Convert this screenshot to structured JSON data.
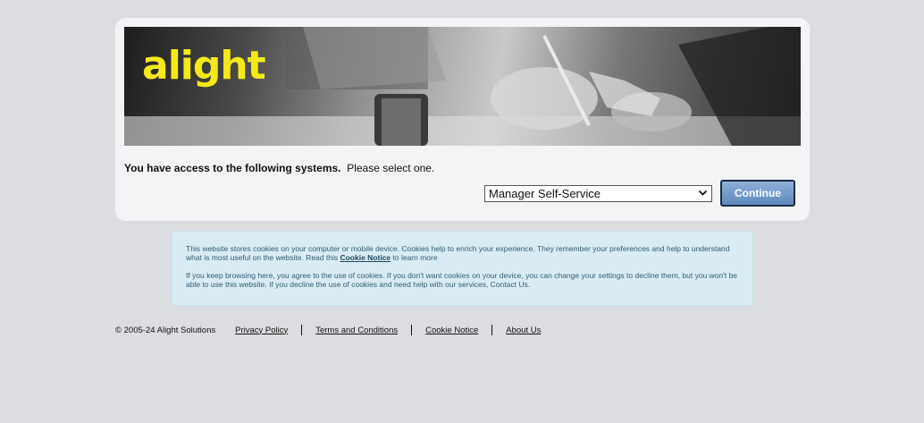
{
  "brand": {
    "logo_text": "alight",
    "logo_color": "#f5e918"
  },
  "selection": {
    "prompt_bold": "You have access to the following systems.",
    "prompt_rest": "Please select one.",
    "selected_system": "Manager Self-Service",
    "continue_label": "Continue"
  },
  "cookie_notice": {
    "p1_before": "This website stores cookies on your computer or mobile device. Cookies help to enrich your experience. They remember your preferences and help to understand what is most useful on the website. Read this ",
    "p1_link": "Cookie Notice",
    "p1_after": " to learn more",
    "p2": "If you keep browsing here, you agree to the use of cookies. If you don't want cookies on your device, you can change your settings to decline them, but you won't be able to use this website. If you decline the use of cookies and need help with our services, Contact Us."
  },
  "footer": {
    "copyright": "© 2005-24 Alight Solutions",
    "links": [
      "Privacy Policy",
      "Terms and Conditions",
      "Cookie Notice",
      "About Us"
    ]
  },
  "colors": {
    "button_top": "#8fb0d6",
    "button_bottom": "#5d88bd",
    "cookie_bg": "#d9ecf4"
  }
}
